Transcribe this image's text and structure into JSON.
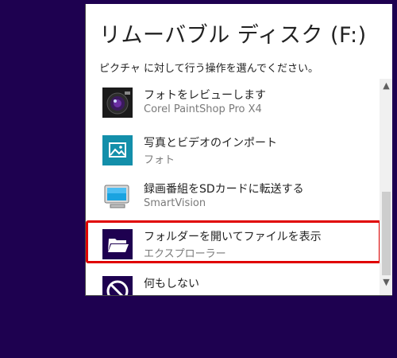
{
  "dialog": {
    "title": "リムーバブル ディスク (F:)",
    "subtitle": "ピクチャ に対して行う操作を選んでください。"
  },
  "actions": [
    {
      "name": "フォトをレビューします",
      "app": "Corel PaintShop Pro X4",
      "icon": "camera-lens-icon",
      "tile_color": "#1b1b1b"
    },
    {
      "name": "写真とビデオのインポート",
      "app": "フォト",
      "icon": "photo-picture-icon",
      "tile_color": "#138faa"
    },
    {
      "name": "録画番組をSDカードに転送する",
      "app": "SmartVision",
      "icon": "monitor-icon",
      "tile_color": "#ffffff"
    },
    {
      "name": "フォルダーを開いてファイルを表示",
      "app": "エクスプローラー",
      "icon": "folder-open-icon",
      "tile_color": "#1e0150",
      "selected": true
    },
    {
      "name": "何もしない",
      "app": "",
      "icon": "no-action-icon",
      "tile_color": "#1e0150"
    }
  ],
  "colors": {
    "desktop_background": "#1e0150",
    "selection_border": "#e00000"
  },
  "scrollbar": {
    "up_arrow": "▲",
    "down_arrow": "▼"
  }
}
